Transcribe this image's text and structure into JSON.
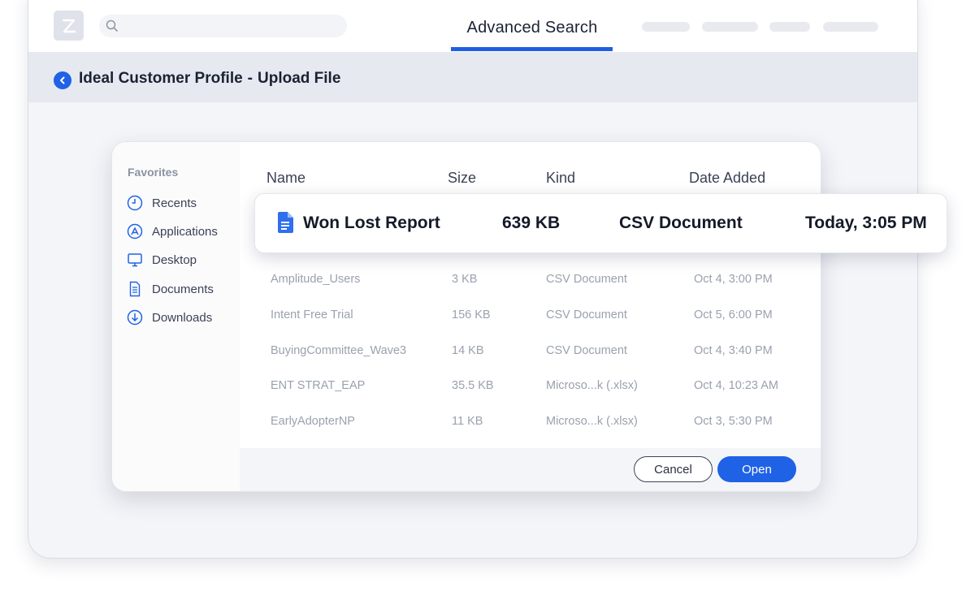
{
  "header": {
    "active_tab": "Advanced Search",
    "search_placeholder": "",
    "accent_color": "#1f62e6"
  },
  "breadcrumb": {
    "items": [
      "Ideal Customer Profile",
      "Upload File"
    ],
    "separator": "-"
  },
  "dialog": {
    "sidebar": {
      "title": "Favorites",
      "items": [
        {
          "label": "Recents",
          "icon": "clock-icon"
        },
        {
          "label": "Applications",
          "icon": "applications-icon"
        },
        {
          "label": "Desktop",
          "icon": "monitor-icon"
        },
        {
          "label": "Documents",
          "icon": "document-icon"
        },
        {
          "label": "Downloads",
          "icon": "download-icon"
        }
      ]
    },
    "columns": [
      "Name",
      "Size",
      "Kind",
      "Date Added"
    ],
    "selected_file": {
      "name": "Won Lost Report",
      "size": "639 KB",
      "kind": "CSV Document",
      "date": "Today, 3:05 PM",
      "icon": "google-doc-icon"
    },
    "files": [
      {
        "name": "Amplitude_Users",
        "size": "3 KB",
        "kind": "CSV Document",
        "date": "Oct 4, 3:00 PM"
      },
      {
        "name": "Intent Free Trial",
        "size": "156 KB",
        "kind": "CSV Document",
        "date": "Oct 5, 6:00 PM"
      },
      {
        "name": "BuyingCommittee_Wave3",
        "size": "14 KB",
        "kind": "CSV Document",
        "date": "Oct 4, 3:40 PM"
      },
      {
        "name": "ENT STRAT_EAP",
        "size": "35.5 KB",
        "kind": "Microso...k (.xlsx)",
        "date": "Oct 4, 10:23 AM"
      },
      {
        "name": "EarlyAdopterNP",
        "size": "11 KB",
        "kind": "Microso...k (.xlsx)",
        "date": "Oct 3, 5:30 PM"
      }
    ],
    "buttons": {
      "cancel": "Cancel",
      "open": "Open"
    }
  }
}
